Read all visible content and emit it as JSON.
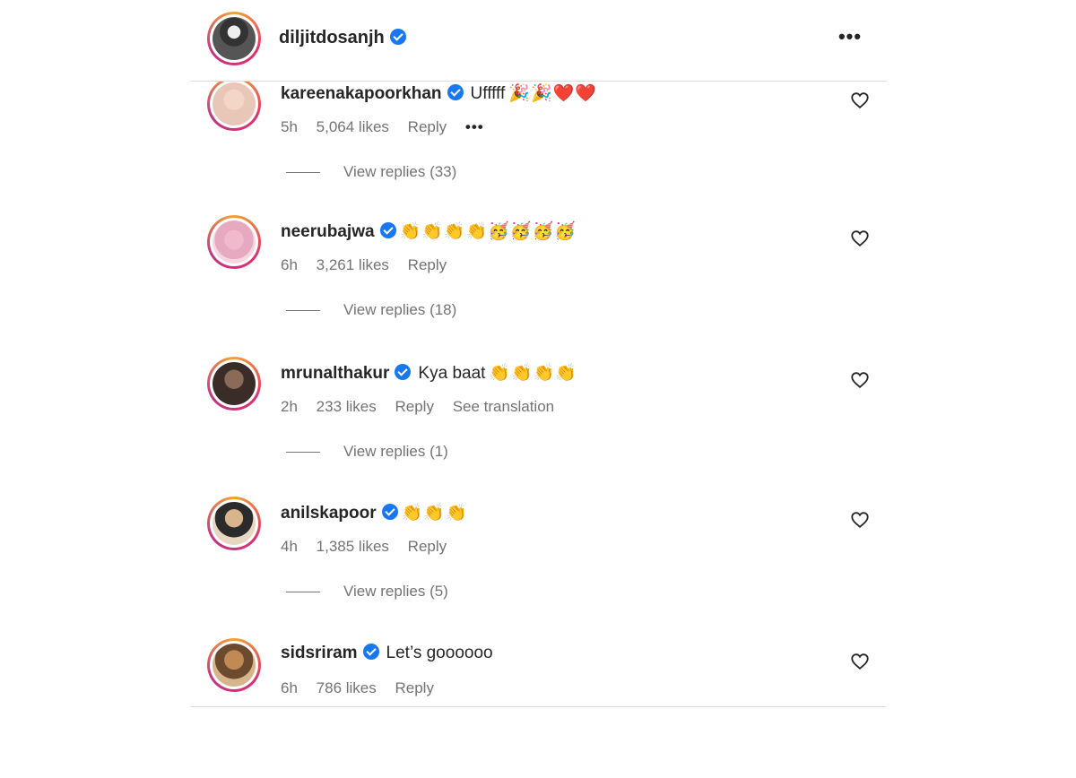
{
  "post": {
    "username": "diljitdosanjh",
    "more_label": "•••"
  },
  "comments": [
    {
      "username": "kareenakapoorkhan",
      "text": "Ufffff",
      "emojis": "🎉🎉❤️❤️",
      "time": "5h",
      "likes": "5,064 likes",
      "reply_label": "Reply",
      "extra": "•••",
      "view_replies": "View replies (33)",
      "avatar_color": "#e8c7b8"
    },
    {
      "username": "neerubajwa",
      "text": "",
      "emojis": "👏👏👏👏🥳🥳🥳🥳",
      "time": "6h",
      "likes": "3,261 likes",
      "reply_label": "Reply",
      "extra": "",
      "view_replies": "View replies (18)",
      "avatar_color": "#e7a9c0"
    },
    {
      "username": "mrunalthakur",
      "text": "Kya baat",
      "emojis": "👏👏👏👏",
      "time": "2h",
      "likes": "233 likes",
      "reply_label": "Reply",
      "extra": "See translation",
      "view_replies": "View replies (1)",
      "avatar_color": "#4a3a32"
    },
    {
      "username": "anilskapoor",
      "text": "",
      "emojis": "👏👏👏",
      "time": "4h",
      "likes": "1,385 likes",
      "reply_label": "Reply",
      "extra": "",
      "view_replies": "View replies (5)",
      "avatar_color": "#c9a77c"
    },
    {
      "username": "sidsriram",
      "text": "Let’s goooooo",
      "emojis": "",
      "time": "6h",
      "likes": "786 likes",
      "reply_label": "Reply",
      "extra": "",
      "view_replies": "",
      "avatar_color": "#b07a48"
    }
  ],
  "colors": {
    "verified": "#1877f2",
    "meta_text": "#737373",
    "story_ring": "#e1306c"
  }
}
